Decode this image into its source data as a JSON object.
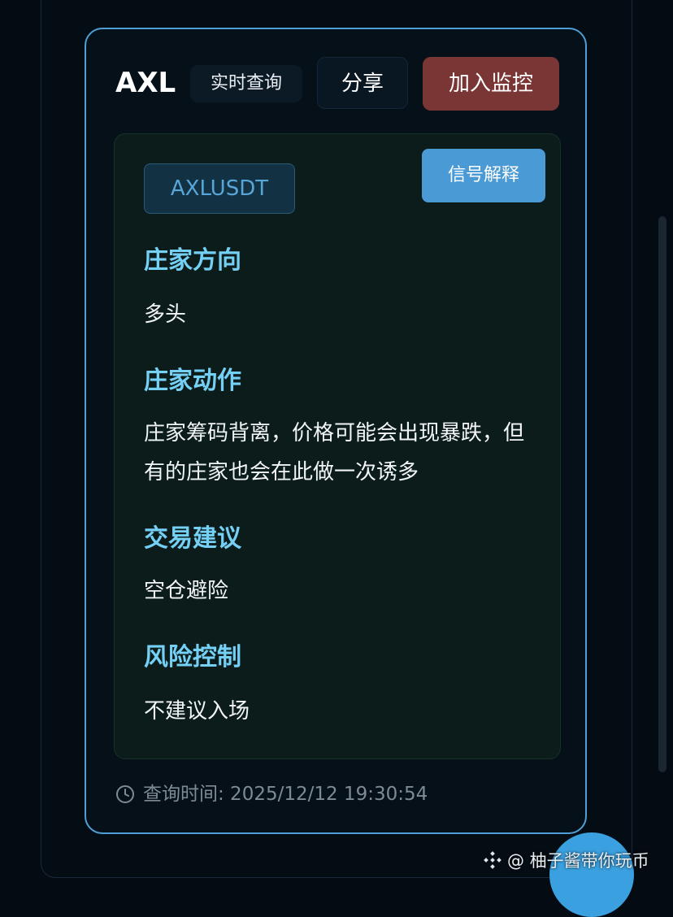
{
  "header": {
    "symbol": "AXL",
    "query_label": "实时查询",
    "share_label": "分享",
    "monitor_label": "加入监控"
  },
  "panel": {
    "pair": "AXLUSDT",
    "explain_label": "信号解释",
    "sections": [
      {
        "title": "庄家方向",
        "body": "多头"
      },
      {
        "title": "庄家动作",
        "body": "庄家筹码背离，价格可能会出现暴跌，但有的庄家也会在此做一次诱多"
      },
      {
        "title": "交易建议",
        "body": "空仓避险"
      },
      {
        "title": "风险控制",
        "body": "不建议入场"
      }
    ]
  },
  "footer": {
    "query_time": "查询时间: 2025/12/12 19:30:54"
  },
  "watermark": {
    "text": "@ 柚子酱带你玩币"
  },
  "colors": {
    "accent_border": "#4e9fd8",
    "monitor_button": "#7a3535",
    "explain_button": "#4a9ad6",
    "section_title": "#74d0f5",
    "pair_text": "#58a6d8"
  },
  "icons": {
    "clock": "clock-icon",
    "watermark": "binance-logo-icon"
  }
}
